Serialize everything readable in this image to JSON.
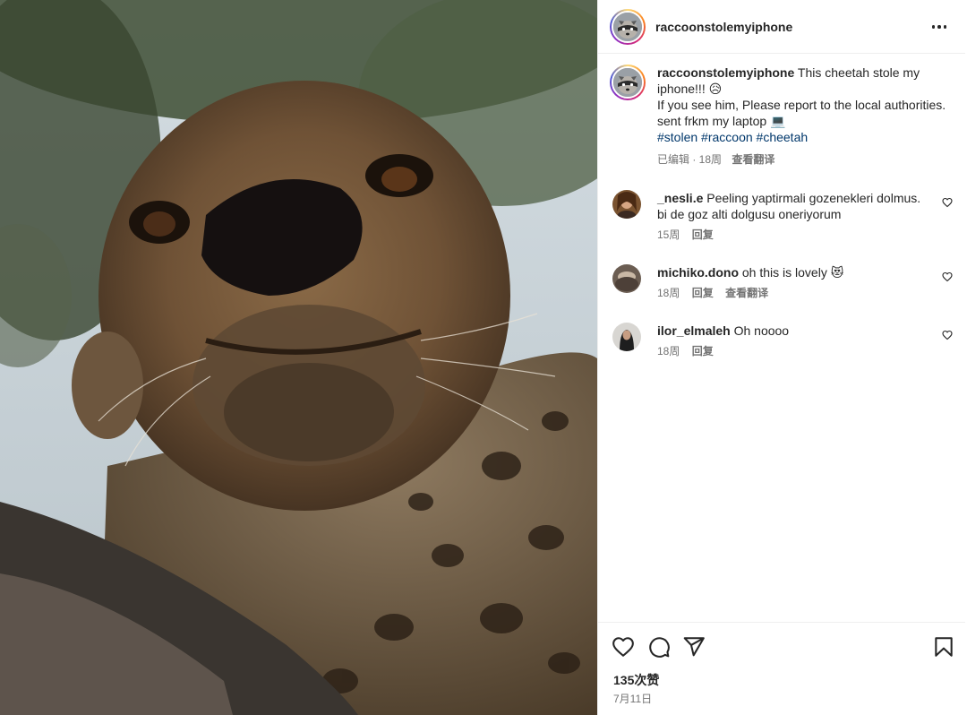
{
  "post": {
    "username": "raccoonstolemyiphone",
    "more_icon": "more-horizontal-icon",
    "likes": "135次赞",
    "date": "7月11日"
  },
  "caption": {
    "username": "raccoonstolemyiphone",
    "line1": "This cheetah stole my iphone!!! 😥",
    "line2": "If you see him, Please report to the local authorities.",
    "line3": "sent frkm my laptop 💻",
    "hashtags": [
      "#stolen",
      "#raccoon",
      "#cheetah"
    ],
    "edited": "已编辑 · 18周",
    "translate": "查看翻译"
  },
  "comments": [
    {
      "username": "_nesli.e",
      "text": "Peeling yaptirmali gozenekleri dolmus. bi de goz alti dolgusu oneriyorum",
      "time": "15周",
      "reply": "回复",
      "translate": null,
      "avatar_color": "#7a5330"
    },
    {
      "username": "michiko.dono",
      "text": "oh this is lovely 😻",
      "time": "18周",
      "reply": "回复",
      "translate": "查看翻译",
      "avatar_color": "#6b5d52"
    },
    {
      "username": "ilor_elmaleh",
      "text": "Oh noooo",
      "time": "18周",
      "reply": "回复",
      "translate": null,
      "avatar_color": "#2f2f2f"
    }
  ],
  "icons": {
    "like": "heart-icon",
    "comment": "comment-icon",
    "share": "send-icon",
    "save": "bookmark-icon"
  },
  "colors": {
    "text": "#262626",
    "secondary": "#737373",
    "link": "#00376b",
    "border": "#efefef"
  }
}
